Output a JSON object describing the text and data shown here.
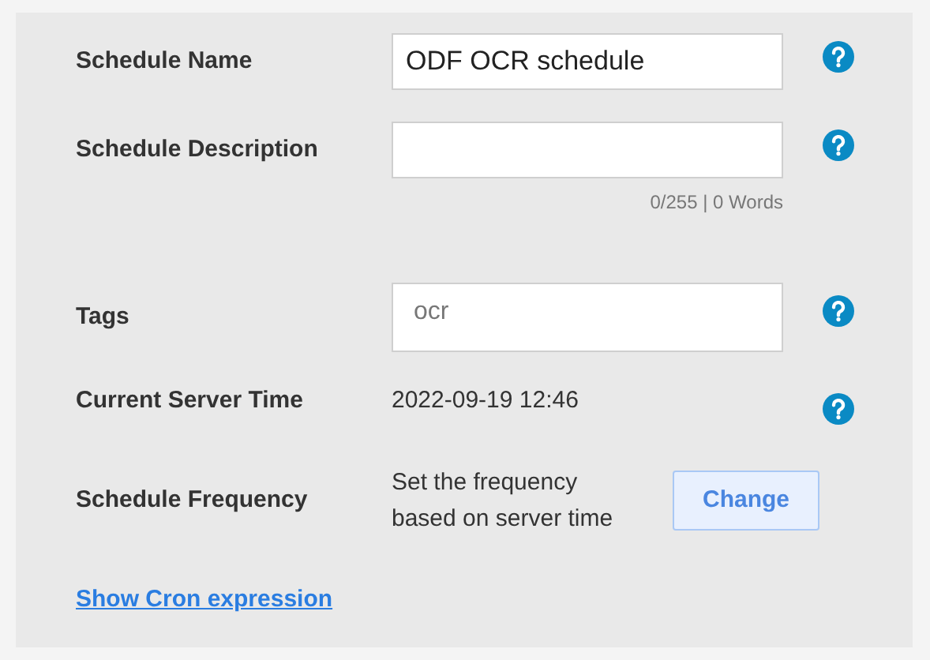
{
  "rows": [
    {
      "kind": "input",
      "label": "Schedule Name",
      "value": "ODF OCR schedule",
      "help": true
    },
    {
      "kind": "textarea",
      "label": "Schedule Description",
      "counter": "0/255 | 0 Words",
      "help": true
    },
    {
      "kind": "tags",
      "label": "Tags",
      "tags": [
        "ocr"
      ],
      "help": true
    },
    {
      "kind": "text",
      "label": "Current Server Time",
      "text": "2022-09-19 12:46",
      "help": true
    },
    {
      "kind": "frequency",
      "label": "Schedule Frequency",
      "text": "Set the frequency based on server time",
      "button": "Change",
      "help": false
    }
  ],
  "link": "Show Cron expression"
}
